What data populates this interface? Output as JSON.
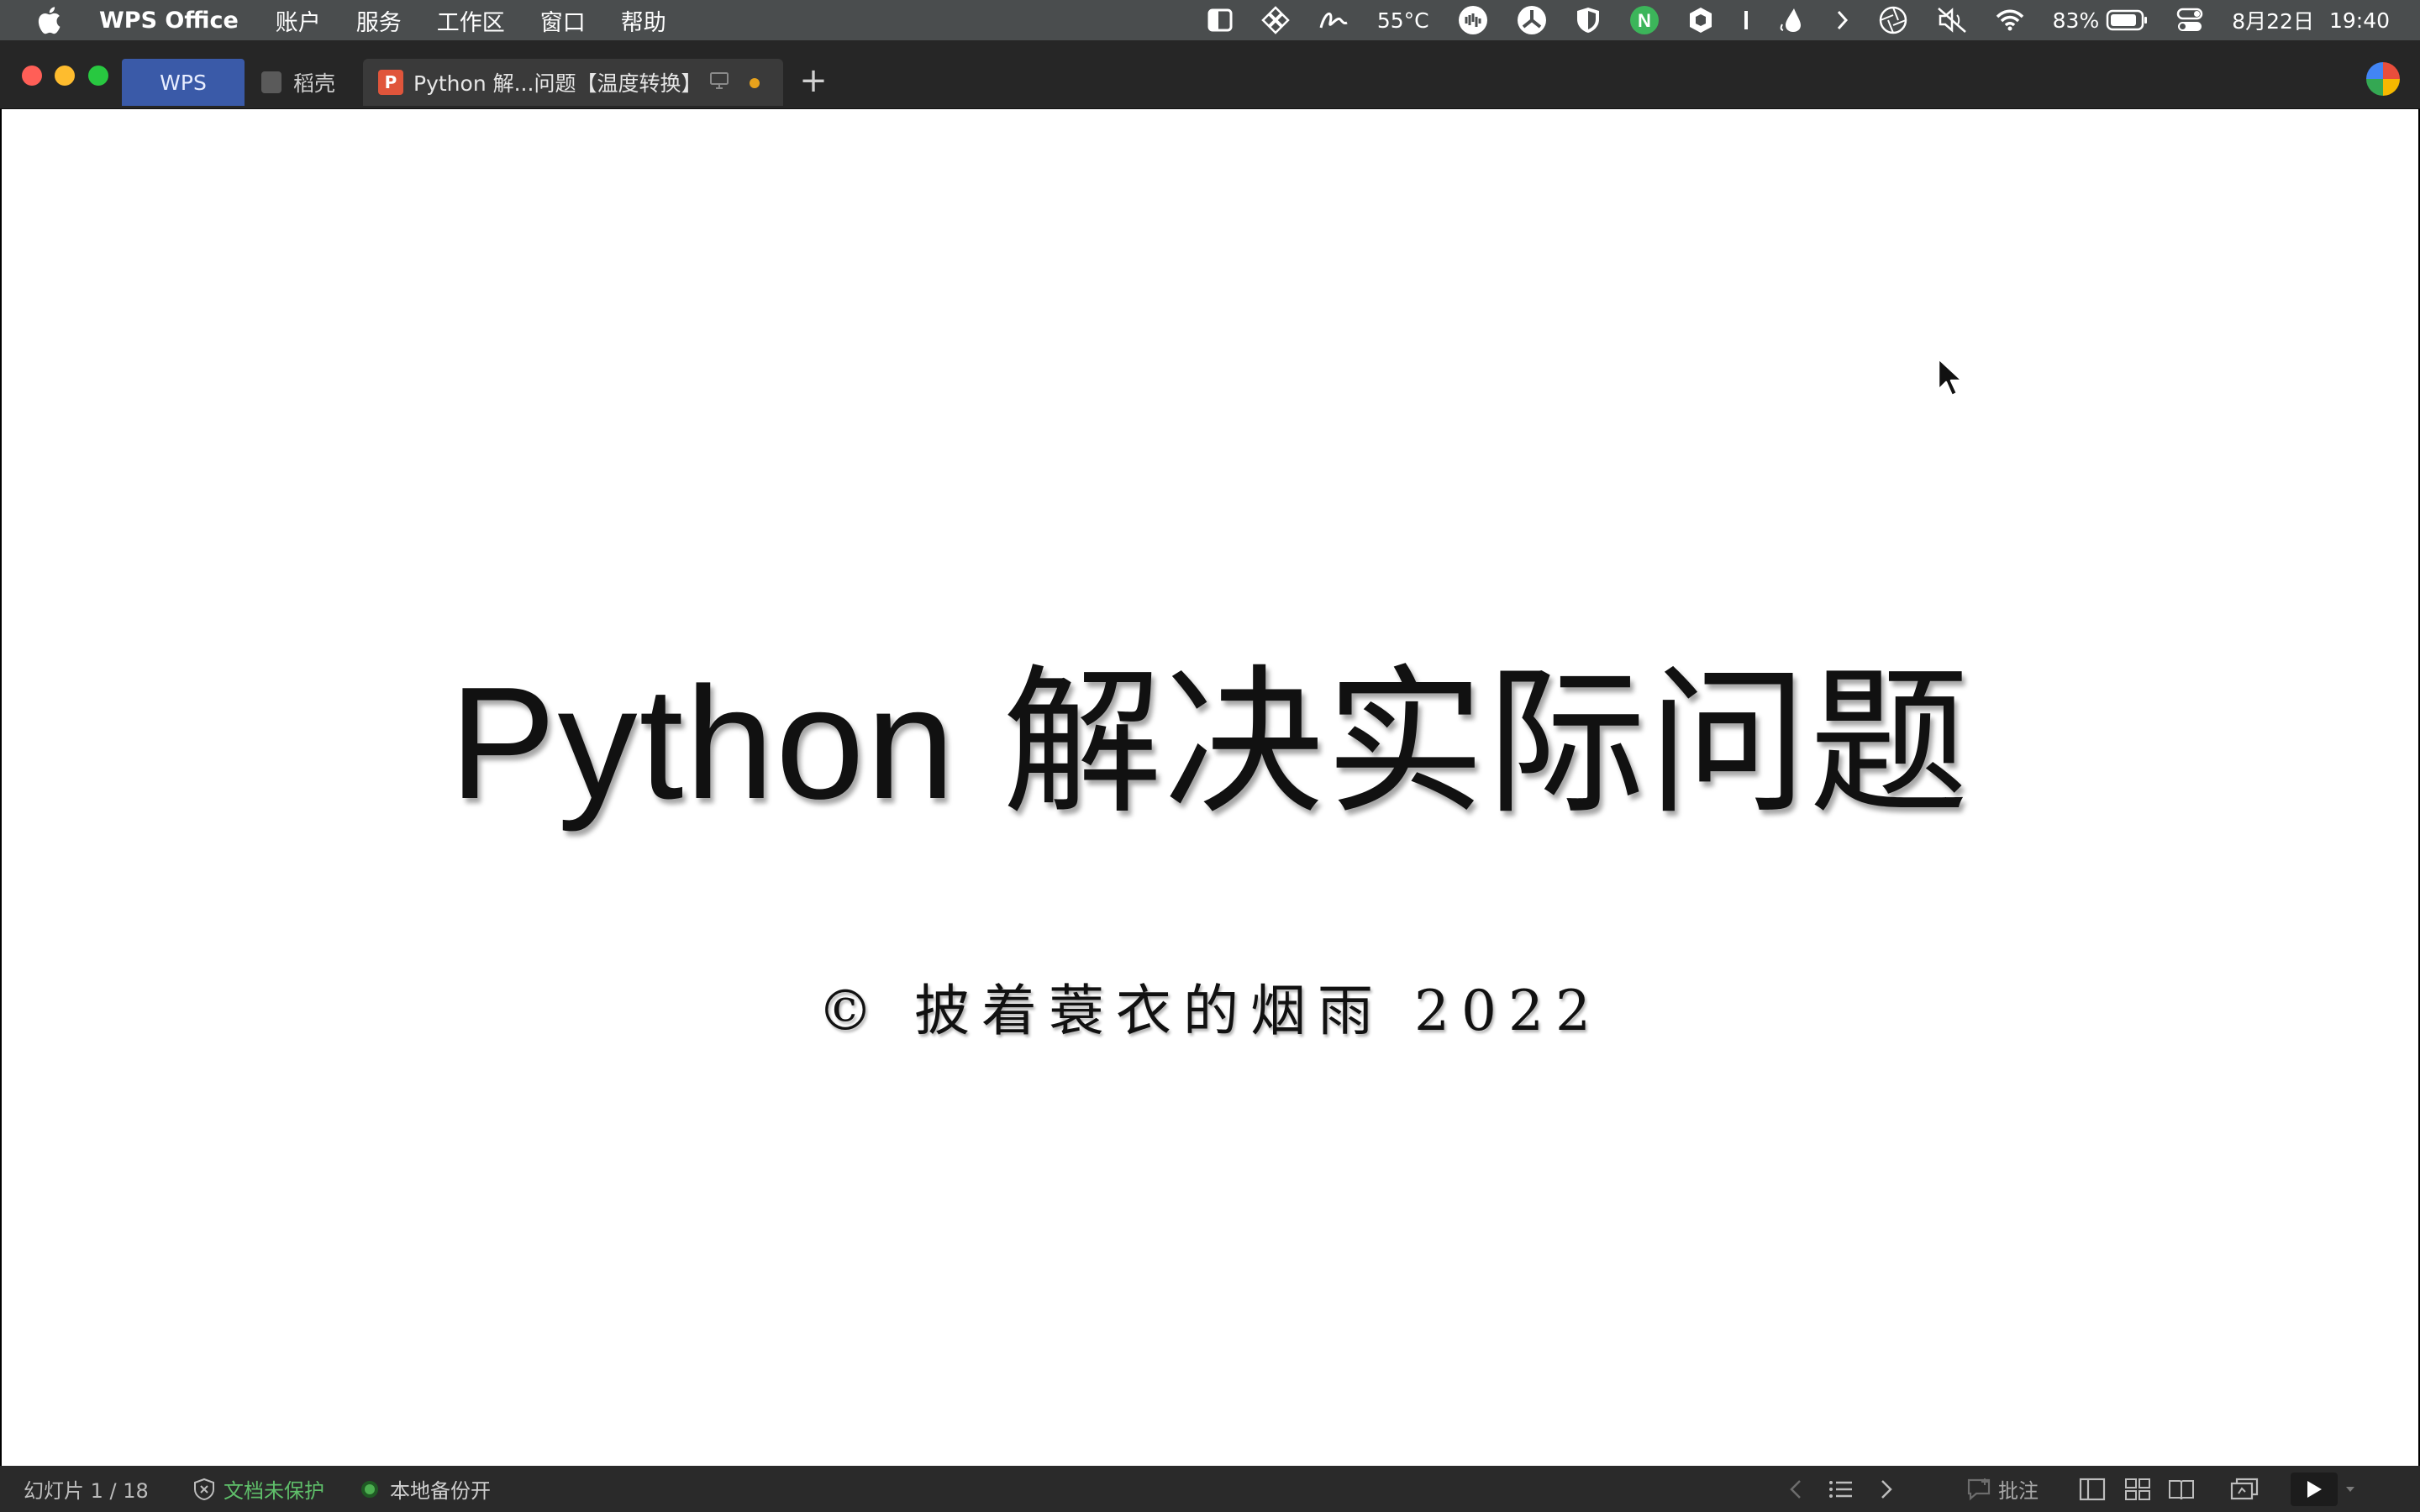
{
  "menubar": {
    "app_name": "WPS Office",
    "items": [
      "账户",
      "服务",
      "工作区",
      "窗口",
      "帮助"
    ],
    "temperature": "55°C",
    "battery": "83%",
    "date": "8月22日",
    "time": "19:40"
  },
  "tabs": {
    "wps": "WPS",
    "daoke": "稻壳",
    "doc": "Python 解...问题【温度转换】",
    "add": "+"
  },
  "slide": {
    "title": "Python 解决实际问题",
    "subtitle": "© 披着蓑衣的烟雨 2022"
  },
  "statusbar": {
    "slide_counter": "幻灯片 1 / 18",
    "protect": "文档未保护",
    "backup": "本地备份开",
    "comment": "批注"
  },
  "colors": {
    "tab_active": "#3a5aa8",
    "protect_green": "#5fbf6a",
    "doc_icon": "#e0553b"
  }
}
